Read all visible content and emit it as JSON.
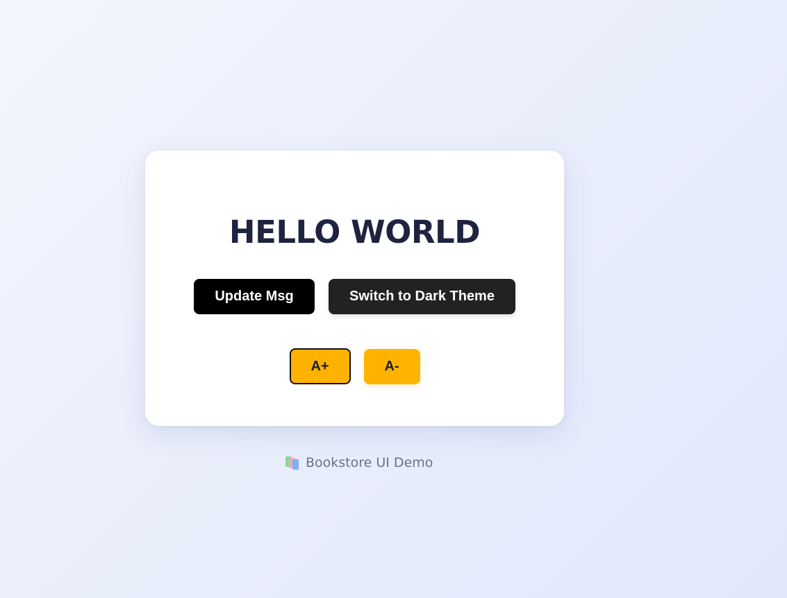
{
  "card": {
    "title": "HELLO WORLD",
    "buttons": {
      "update_label": "Update Msg",
      "theme_label": "Switch to Dark Theme"
    },
    "font_controls": {
      "increase_label": "A+",
      "decrease_label": "A-"
    }
  },
  "footer": {
    "icon": "books-icon",
    "text": "Bookstore UI Demo"
  },
  "colors": {
    "accent": "#ffb300",
    "title": "#1f2340",
    "primary_button": "#000000",
    "secondary_button": "#222222"
  }
}
